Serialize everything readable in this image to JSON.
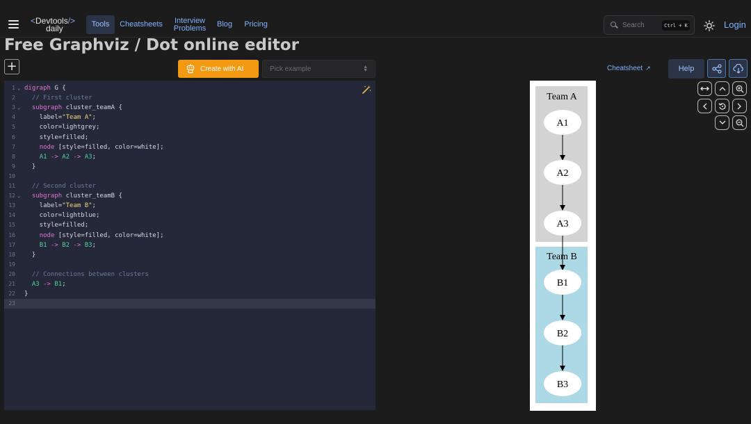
{
  "nav": {
    "logo_line1_left": "<",
    "logo_line1_text": "Devtools",
    "logo_line1_right": "/>",
    "logo_line2": "daily",
    "links": [
      {
        "label": "Tools",
        "active": true
      },
      {
        "label": "Cheatsheets",
        "active": false
      },
      {
        "label": "Interview Problems",
        "active": false
      },
      {
        "label": "Blog",
        "active": false
      },
      {
        "label": "Pricing",
        "active": false
      }
    ],
    "search_placeholder": "Search",
    "search_shortcut": "Ctrl + K",
    "login": "Login"
  },
  "page_title": "Free Graphviz / Dot online editor",
  "toolbar": {
    "create_ai": "Create with AI",
    "pick_example": "Pick example",
    "cheatsheet": "Cheatsheet",
    "help": "Help"
  },
  "editor": {
    "active_line": 23,
    "fold_lines": [
      1,
      3,
      12
    ],
    "lines": [
      "digraph G {",
      "  // First cluster",
      "  subgraph cluster_teamA {",
      "    label=\"Team A\";",
      "    color=lightgrey;",
      "    style=filled;",
      "    node [style=filled, color=white];",
      "    A1 -> A2 -> A3;",
      "  }",
      "",
      "  // Second cluster",
      "  subgraph cluster_teamB {",
      "    label=\"Team B\";",
      "    color=lightblue;",
      "    style=filled;",
      "    node [style=filled, color=white];",
      "    B1 -> B2 -> B3;",
      "  }",
      "",
      "  // Connections between clusters",
      "  A3 -> B1;",
      "}",
      ""
    ]
  },
  "graph": {
    "clusters": [
      {
        "label": "Team A",
        "color": "#d3d3d3",
        "nodes": [
          "A1",
          "A2",
          "A3"
        ]
      },
      {
        "label": "Team B",
        "color": "#add8e6",
        "nodes": [
          "B1",
          "B2",
          "B3"
        ]
      }
    ]
  },
  "colors": {
    "accent": "#7fb1ff",
    "ai_button": "#f39a12",
    "editor_bg": "#242839"
  }
}
